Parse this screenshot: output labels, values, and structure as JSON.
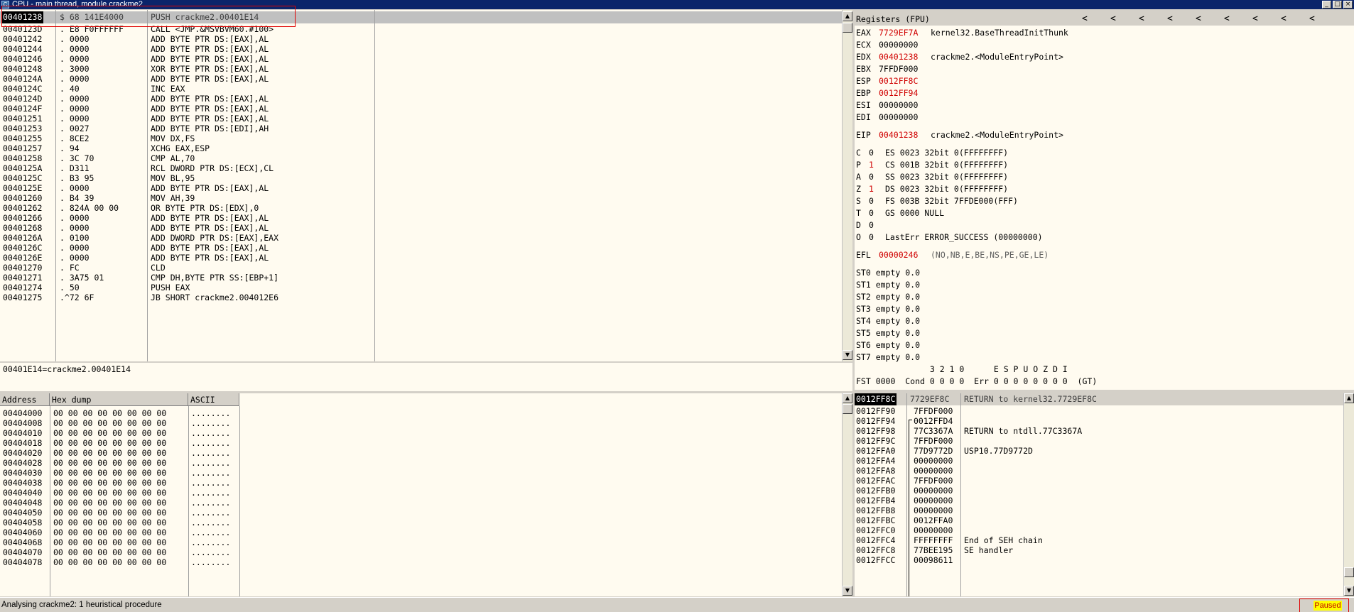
{
  "window": {
    "title": "CPU - main thread, module crackme2",
    "buttons": {
      "minimize": "_",
      "maximize": "□",
      "close": "×"
    }
  },
  "disasm": {
    "highlight_row": {
      "addr": "00401238",
      "hex": "$ 68 141E4000",
      "instr": "PUSH crackme2.00401E14"
    },
    "rows": [
      {
        "addr": "0040123D",
        "hex": ". E8 F0FFFFFF",
        "instr": "CALL <JMP.&MSVBVM60.#100>"
      },
      {
        "addr": "00401242",
        "hex": ". 0000",
        "instr": "ADD BYTE PTR DS:[EAX],AL"
      },
      {
        "addr": "00401244",
        "hex": ". 0000",
        "instr": "ADD BYTE PTR DS:[EAX],AL"
      },
      {
        "addr": "00401246",
        "hex": ". 0000",
        "instr": "ADD BYTE PTR DS:[EAX],AL"
      },
      {
        "addr": "00401248",
        "hex": ". 3000",
        "instr": "XOR BYTE PTR DS:[EAX],AL"
      },
      {
        "addr": "0040124A",
        "hex": ". 0000",
        "instr": "ADD BYTE PTR DS:[EAX],AL"
      },
      {
        "addr": "0040124C",
        "hex": ". 40",
        "instr": "INC EAX"
      },
      {
        "addr": "0040124D",
        "hex": ". 0000",
        "instr": "ADD BYTE PTR DS:[EAX],AL"
      },
      {
        "addr": "0040124F",
        "hex": ". 0000",
        "instr": "ADD BYTE PTR DS:[EAX],AL"
      },
      {
        "addr": "00401251",
        "hex": ". 0000",
        "instr": "ADD BYTE PTR DS:[EAX],AL"
      },
      {
        "addr": "00401253",
        "hex": ". 0027",
        "instr": "ADD BYTE PTR DS:[EDI],AH"
      },
      {
        "addr": "00401255",
        "hex": ". 8CE2",
        "instr": "MOV DX,FS"
      },
      {
        "addr": "00401257",
        "hex": ". 94",
        "instr": "XCHG EAX,ESP"
      },
      {
        "addr": "00401258",
        "hex": ". 3C 70",
        "instr": "CMP AL,70"
      },
      {
        "addr": "0040125A",
        "hex": ". D311",
        "instr": "RCL DWORD PTR DS:[ECX],CL"
      },
      {
        "addr": "0040125C",
        "hex": ". B3 95",
        "instr": "MOV BL,95"
      },
      {
        "addr": "0040125E",
        "hex": ". 0000",
        "instr": "ADD BYTE PTR DS:[EAX],AL"
      },
      {
        "addr": "00401260",
        "hex": ". B4 39",
        "instr": "MOV AH,39"
      },
      {
        "addr": "00401262",
        "hex": ". 824A 00 00",
        "instr": "OR BYTE PTR DS:[EDX],0"
      },
      {
        "addr": "00401266",
        "hex": ". 0000",
        "instr": "ADD BYTE PTR DS:[EAX],AL"
      },
      {
        "addr": "00401268",
        "hex": ". 0000",
        "instr": "ADD BYTE PTR DS:[EAX],AL"
      },
      {
        "addr": "0040126A",
        "hex": ". 0100",
        "instr": "ADD DWORD PTR DS:[EAX],EAX"
      },
      {
        "addr": "0040126C",
        "hex": ". 0000",
        "instr": "ADD BYTE PTR DS:[EAX],AL"
      },
      {
        "addr": "0040126E",
        "hex": ". 0000",
        "instr": "ADD BYTE PTR DS:[EAX],AL"
      },
      {
        "addr": "00401270",
        "hex": ". FC",
        "instr": "CLD"
      },
      {
        "addr": "00401271",
        "hex": ". 3A75 01",
        "instr": "CMP DH,BYTE PTR SS:[EBP+1]"
      },
      {
        "addr": "00401274",
        "hex": ". 50",
        "instr": "PUSH EAX"
      },
      {
        "addr": "00401275",
        "hex": ".^72 6F",
        "instr": "JB SHORT crackme2.004012E6"
      }
    ]
  },
  "info_line": "00401E14=crackme2.00401E14",
  "registers": {
    "header": "Registers (FPU)",
    "chevrons": [
      "<",
      "<",
      "<",
      "<",
      "<",
      "<",
      "<",
      "<",
      "<"
    ],
    "gp": [
      {
        "name": "EAX",
        "value": "7729EF7A",
        "changed": true,
        "comment": "kernel32.BaseThreadInitThunk"
      },
      {
        "name": "ECX",
        "value": "00000000",
        "changed": false,
        "comment": ""
      },
      {
        "name": "EDX",
        "value": "00401238",
        "changed": true,
        "comment": "crackme2.<ModuleEntryPoint>"
      },
      {
        "name": "EBX",
        "value": "7FFDF000",
        "changed": false,
        "comment": ""
      },
      {
        "name": "ESP",
        "value": "0012FF8C",
        "changed": true,
        "comment": ""
      },
      {
        "name": "EBP",
        "value": "0012FF94",
        "changed": true,
        "comment": ""
      },
      {
        "name": "ESI",
        "value": "00000000",
        "changed": false,
        "comment": ""
      },
      {
        "name": "EDI",
        "value": "00000000",
        "changed": false,
        "comment": ""
      }
    ],
    "eip": {
      "name": "EIP",
      "value": "00401238",
      "comment": "crackme2.<ModuleEntryPoint>"
    },
    "flags": [
      {
        "flag": "C",
        "val": "0",
        "changed": false,
        "seg": "ES 0023 32bit 0(FFFFFFFF)"
      },
      {
        "flag": "P",
        "val": "1",
        "changed": true,
        "seg": "CS 001B 32bit 0(FFFFFFFF)"
      },
      {
        "flag": "A",
        "val": "0",
        "changed": false,
        "seg": "SS 0023 32bit 0(FFFFFFFF)"
      },
      {
        "flag": "Z",
        "val": "1",
        "changed": true,
        "seg": "DS 0023 32bit 0(FFFFFFFF)"
      },
      {
        "flag": "S",
        "val": "0",
        "changed": false,
        "seg": "FS 003B 32bit 7FFDE000(FFF)"
      },
      {
        "flag": "T",
        "val": "0",
        "changed": false,
        "seg": "GS 0000 NULL"
      },
      {
        "flag": "D",
        "val": "0",
        "changed": false,
        "seg": ""
      },
      {
        "flag": "O",
        "val": "0",
        "changed": false,
        "seg": "LastErr ERROR_SUCCESS (00000000)"
      }
    ],
    "efl": {
      "name": "EFL",
      "value": "00000246",
      "comment": "(NO,NB,E,BE,NS,PE,GE,LE)"
    },
    "st": [
      "ST0 empty 0.0",
      "ST1 empty 0.0",
      "ST2 empty 0.0",
      "ST3 empty 0.0",
      "ST4 empty 0.0",
      "ST5 empty 0.0",
      "ST6 empty 0.0",
      "ST7 empty 0.0"
    ],
    "fst_header": "               3 2 1 0      E S P U O Z D I",
    "fst": "FST 0000  Cond 0 0 0 0  Err 0 0 0 0 0 0 0 0  (GT)"
  },
  "dump": {
    "headers": {
      "address": "Address",
      "hex": "Hex dump",
      "ascii": "ASCII"
    },
    "rows": [
      {
        "addr": "00404000",
        "hex": "00 00 00 00 00 00 00 00",
        "ascii": "........"
      },
      {
        "addr": "00404008",
        "hex": "00 00 00 00 00 00 00 00",
        "ascii": "........"
      },
      {
        "addr": "00404010",
        "hex": "00 00 00 00 00 00 00 00",
        "ascii": "........"
      },
      {
        "addr": "00404018",
        "hex": "00 00 00 00 00 00 00 00",
        "ascii": "........"
      },
      {
        "addr": "00404020",
        "hex": "00 00 00 00 00 00 00 00",
        "ascii": "........"
      },
      {
        "addr": "00404028",
        "hex": "00 00 00 00 00 00 00 00",
        "ascii": "........"
      },
      {
        "addr": "00404030",
        "hex": "00 00 00 00 00 00 00 00",
        "ascii": "........"
      },
      {
        "addr": "00404038",
        "hex": "00 00 00 00 00 00 00 00",
        "ascii": "........"
      },
      {
        "addr": "00404040",
        "hex": "00 00 00 00 00 00 00 00",
        "ascii": "........"
      },
      {
        "addr": "00404048",
        "hex": "00 00 00 00 00 00 00 00",
        "ascii": "........"
      },
      {
        "addr": "00404050",
        "hex": "00 00 00 00 00 00 00 00",
        "ascii": "........"
      },
      {
        "addr": "00404058",
        "hex": "00 00 00 00 00 00 00 00",
        "ascii": "........"
      },
      {
        "addr": "00404060",
        "hex": "00 00 00 00 00 00 00 00",
        "ascii": "........"
      },
      {
        "addr": "00404068",
        "hex": "00 00 00 00 00 00 00 00",
        "ascii": "........"
      },
      {
        "addr": "00404070",
        "hex": "00 00 00 00 00 00 00 00",
        "ascii": "........"
      },
      {
        "addr": "00404078",
        "hex": "00 00 00 00 00 00 00 00",
        "ascii": "........"
      }
    ]
  },
  "stack": {
    "highlight_row": {
      "addr": "0012FF8C",
      "value": "7729EF8C",
      "comment": "RETURN to kernel32.7729EF8C"
    },
    "rows": [
      {
        "addr": "0012FF90",
        "value": "7FFDF000",
        "comment": ""
      },
      {
        "addr": "0012FF94",
        "value": "0012FFD4",
        "comment": ""
      },
      {
        "addr": "0012FF98",
        "value": "77C3367A",
        "comment": "RETURN to ntdll.77C3367A"
      },
      {
        "addr": "0012FF9C",
        "value": "7FFDF000",
        "comment": ""
      },
      {
        "addr": "0012FFA0",
        "value": "77D9772D",
        "comment": "USP10.77D9772D"
      },
      {
        "addr": "0012FFA4",
        "value": "00000000",
        "comment": ""
      },
      {
        "addr": "0012FFA8",
        "value": "00000000",
        "comment": ""
      },
      {
        "addr": "0012FFAC",
        "value": "7FFDF000",
        "comment": ""
      },
      {
        "addr": "0012FFB0",
        "value": "00000000",
        "comment": ""
      },
      {
        "addr": "0012FFB4",
        "value": "00000000",
        "comment": ""
      },
      {
        "addr": "0012FFB8",
        "value": "00000000",
        "comment": ""
      },
      {
        "addr": "0012FFBC",
        "value": "0012FFA0",
        "comment": ""
      },
      {
        "addr": "0012FFC0",
        "value": "00000000",
        "comment": ""
      },
      {
        "addr": "0012FFC4",
        "value": "FFFFFFFF",
        "comment": "End of SEH chain"
      },
      {
        "addr": "0012FFC8",
        "value": "77BEE195",
        "comment": "SE handler"
      },
      {
        "addr": "0012FFCC",
        "value": "00098611",
        "comment": ""
      }
    ]
  },
  "status": {
    "text": "Analysing crackme2: 1 heuristical procedure",
    "state": "Paused"
  },
  "colors": {
    "changed_register": "#d00000",
    "pane_bg": "#fffbf0",
    "paused_bg": "#ffff00"
  }
}
